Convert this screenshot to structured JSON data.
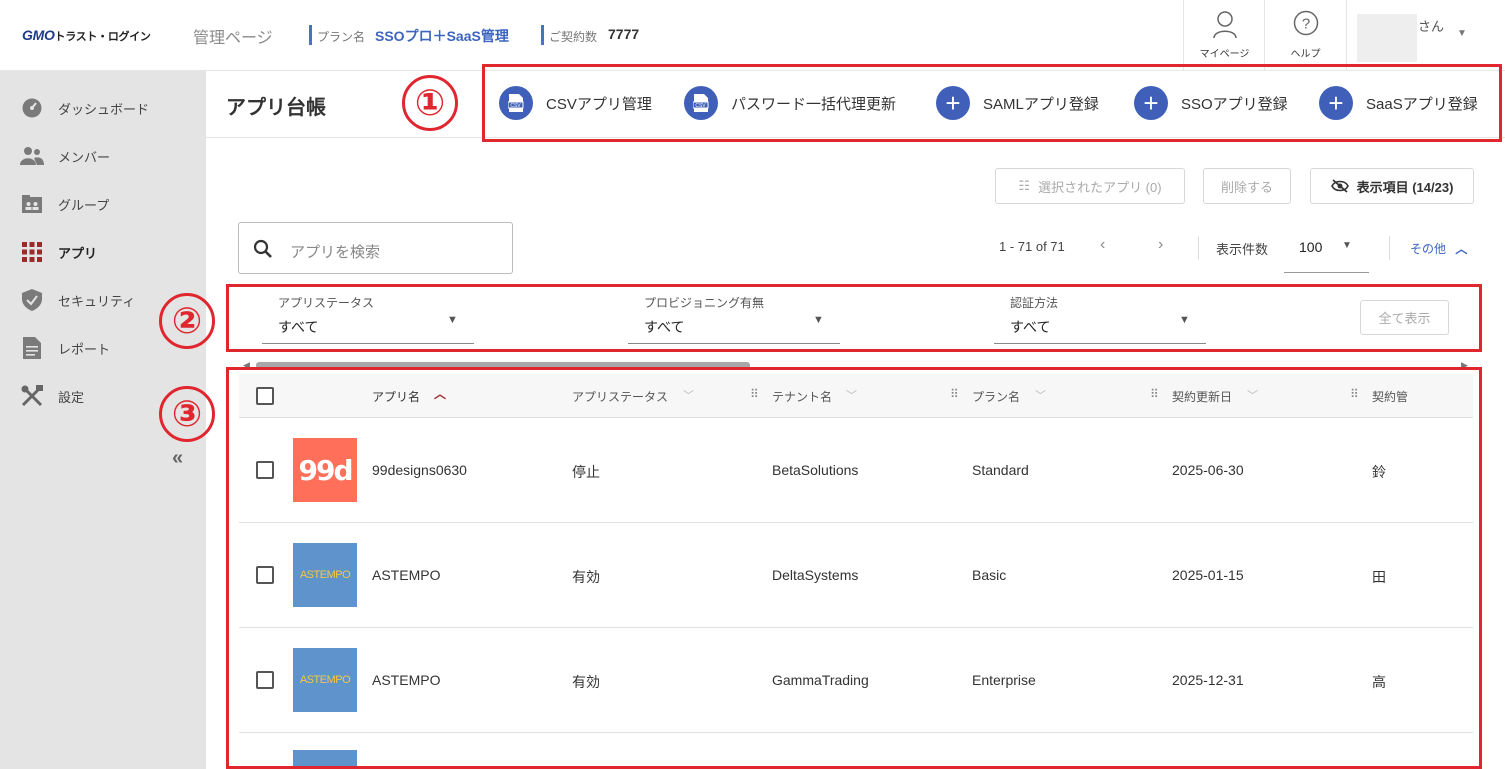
{
  "header": {
    "logo_main": "GMO",
    "logo_sub": "トラスト・ログイン",
    "admin_page": "管理ページ",
    "plan_label": "プラン名",
    "plan_value": "SSOプロ＋SaaS管理",
    "contract_label": "ご契約数",
    "contract_value": "7777",
    "mypage_label": "マイページ",
    "help_label": "ヘルプ",
    "user_suffix": "さん"
  },
  "sidebar": {
    "items": [
      {
        "label": "ダッシュボード",
        "icon": "dashboard-icon"
      },
      {
        "label": "メンバー",
        "icon": "members-icon"
      },
      {
        "label": "グループ",
        "icon": "group-icon"
      },
      {
        "label": "アプリ",
        "icon": "apps-grid-icon",
        "active": true
      },
      {
        "label": "セキュリティ",
        "icon": "shield-icon"
      },
      {
        "label": "レポート",
        "icon": "report-icon"
      },
      {
        "label": "設定",
        "icon": "settings-tools-icon"
      }
    ],
    "collapse": "«"
  },
  "page": {
    "title": "アプリ台帳",
    "annotations": [
      "①",
      "②",
      "③"
    ]
  },
  "actions": [
    {
      "label": "CSVアプリ管理",
      "icon": "csv-icon"
    },
    {
      "label": "パスワード一括代理更新",
      "icon": "csv-icon"
    },
    {
      "label": "SAMLアプリ登録",
      "icon": "plus-icon"
    },
    {
      "label": "SSOアプリ登録",
      "icon": "plus-icon"
    },
    {
      "label": "SaaSアプリ登録",
      "icon": "plus-icon"
    }
  ],
  "toolbar": {
    "selected_apps": "選択されたアプリ (0)",
    "delete": "削除する",
    "display_items": "表示項目 (14/23)"
  },
  "search": {
    "placeholder": "アプリを検索"
  },
  "pagination": {
    "range": "1 - 71 of 71",
    "per_page_label": "表示件数",
    "per_page_value": "100",
    "more": "その他"
  },
  "filters": [
    {
      "label": "アプリステータス",
      "value": "すべて"
    },
    {
      "label": "プロビジョニング有無",
      "value": "すべて"
    },
    {
      "label": "認証方法",
      "value": "すべて"
    }
  ],
  "filters_show_all": "全て表示",
  "table": {
    "columns": [
      "アプリ名",
      "アプリステータス",
      "テナント名",
      "プラン名",
      "契約更新日",
      "契約管"
    ],
    "rows": [
      {
        "name": "99designs0630",
        "status": "停止",
        "tenant": "BetaSolutions",
        "plan": "Standard",
        "renewal": "2025-06-30",
        "manager": "鈴",
        "logo_text": "99d"
      },
      {
        "name": "ASTEMPO",
        "status": "有効",
        "tenant": "DeltaSystems",
        "plan": "Basic",
        "renewal": "2025-01-15",
        "manager": "田",
        "logo_text": "ASTEMPO"
      },
      {
        "name": "ASTEMPO",
        "status": "有効",
        "tenant": "GammaTrading",
        "plan": "Enterprise",
        "renewal": "2025-12-31",
        "manager": "高",
        "logo_text": "ASTEMPO"
      }
    ]
  },
  "colors": {
    "accent": "#3f5fb8",
    "annotation_red": "#e0262e",
    "sidebar_bg": "#e4e4e4",
    "logo_99d": "#ff6f59",
    "logo_astempo": "#5f93cc"
  }
}
